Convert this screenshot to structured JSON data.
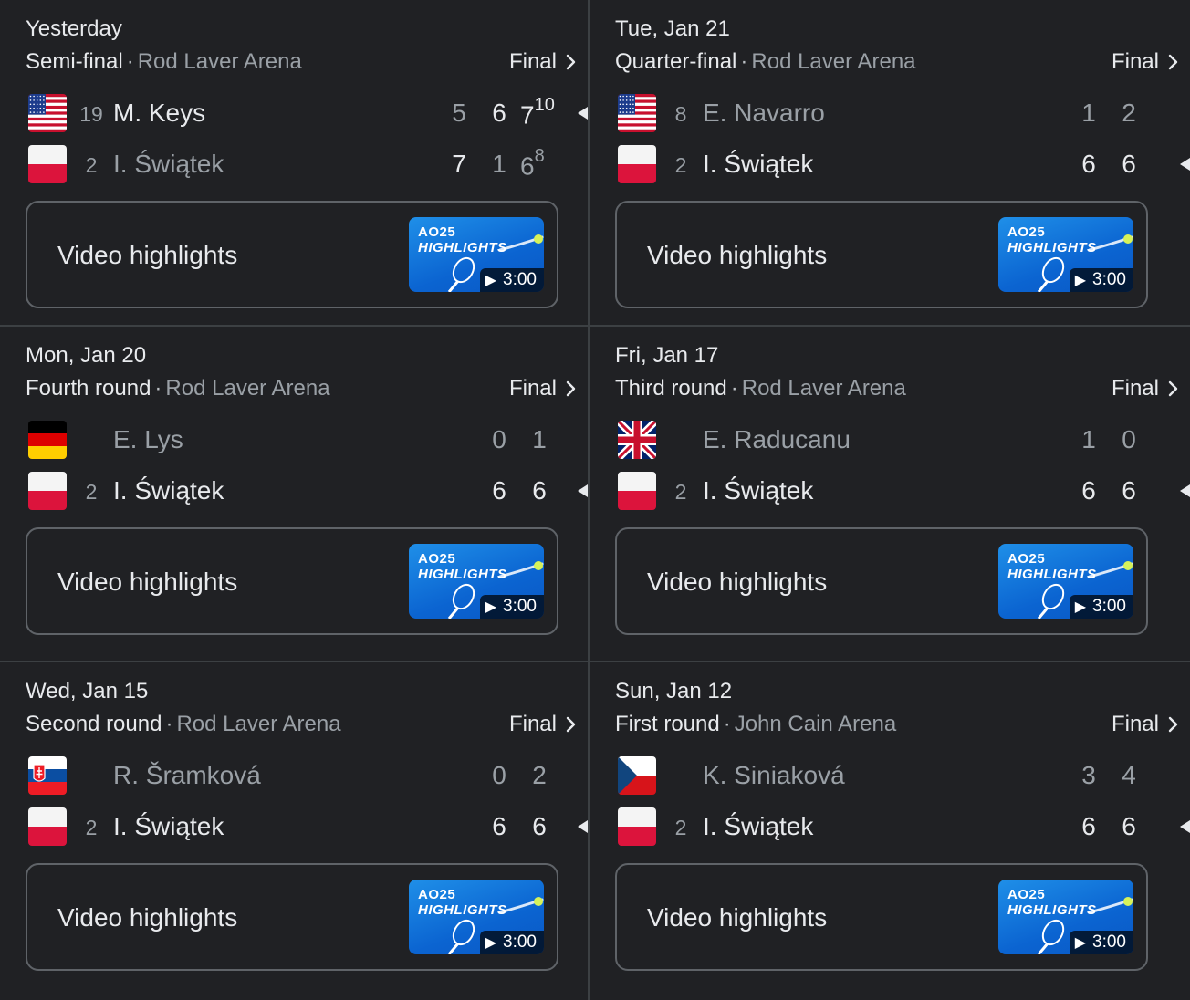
{
  "matches": [
    {
      "date": "Yesterday",
      "round": "Semi-final",
      "venue": "Rod Laver Arena",
      "status": "Final",
      "players": [
        {
          "flag": "usa",
          "seed": "19",
          "name": "M. Keys",
          "winner": true,
          "sets": [
            {
              "v": "5",
              "w": false
            },
            {
              "v": "6",
              "w": true
            },
            {
              "v": "7",
              "tb": "10",
              "w": true
            }
          ]
        },
        {
          "flag": "poland",
          "seed": "2",
          "name": "I. Świątek",
          "winner": false,
          "sets": [
            {
              "v": "7",
              "w": true
            },
            {
              "v": "1",
              "w": false
            },
            {
              "v": "6",
              "tb": "8",
              "w": false
            }
          ]
        }
      ],
      "highlights": {
        "label": "Video highlights",
        "logo": "AO25",
        "title": "HIGHLIGHTS",
        "duration": "3:00"
      }
    },
    {
      "date": "Tue, Jan 21",
      "round": "Quarter-final",
      "venue": "Rod Laver Arena",
      "status": "Final",
      "players": [
        {
          "flag": "usa",
          "seed": "8",
          "name": "E. Navarro",
          "winner": false,
          "sets": [
            {
              "v": "1",
              "w": false
            },
            {
              "v": "2",
              "w": false
            }
          ]
        },
        {
          "flag": "poland",
          "seed": "2",
          "name": "I. Świątek",
          "winner": true,
          "sets": [
            {
              "v": "6",
              "w": true
            },
            {
              "v": "6",
              "w": true
            }
          ]
        }
      ],
      "highlights": {
        "label": "Video highlights",
        "logo": "AO25",
        "title": "HIGHLIGHTS",
        "duration": "3:00"
      }
    },
    {
      "date": "Mon, Jan 20",
      "round": "Fourth round",
      "venue": "Rod Laver Arena",
      "status": "Final",
      "players": [
        {
          "flag": "germany",
          "seed": "",
          "name": "E. Lys",
          "winner": false,
          "sets": [
            {
              "v": "0",
              "w": false
            },
            {
              "v": "1",
              "w": false
            }
          ]
        },
        {
          "flag": "poland",
          "seed": "2",
          "name": "I. Świątek",
          "winner": true,
          "sets": [
            {
              "v": "6",
              "w": true
            },
            {
              "v": "6",
              "w": true
            }
          ]
        }
      ],
      "highlights": {
        "label": "Video highlights",
        "logo": "AO25",
        "title": "HIGHLIGHTS",
        "duration": "3:00"
      }
    },
    {
      "date": "Fri, Jan 17",
      "round": "Third round",
      "venue": "Rod Laver Arena",
      "status": "Final",
      "players": [
        {
          "flag": "uk",
          "seed": "",
          "name": "E. Raducanu",
          "winner": false,
          "sets": [
            {
              "v": "1",
              "w": false
            },
            {
              "v": "0",
              "w": false
            }
          ]
        },
        {
          "flag": "poland",
          "seed": "2",
          "name": "I. Świątek",
          "winner": true,
          "sets": [
            {
              "v": "6",
              "w": true
            },
            {
              "v": "6",
              "w": true
            }
          ]
        }
      ],
      "highlights": {
        "label": "Video highlights",
        "logo": "AO25",
        "title": "HIGHLIGHTS",
        "duration": "3:00"
      }
    },
    {
      "date": "Wed, Jan 15",
      "round": "Second round",
      "venue": "Rod Laver Arena",
      "status": "Final",
      "players": [
        {
          "flag": "slovakia",
          "seed": "",
          "name": "R. Šramková",
          "winner": false,
          "sets": [
            {
              "v": "0",
              "w": false
            },
            {
              "v": "2",
              "w": false
            }
          ]
        },
        {
          "flag": "poland",
          "seed": "2",
          "name": "I. Świątek",
          "winner": true,
          "sets": [
            {
              "v": "6",
              "w": true
            },
            {
              "v": "6",
              "w": true
            }
          ]
        }
      ],
      "highlights": {
        "label": "Video highlights",
        "logo": "AO25",
        "title": "HIGHLIGHTS",
        "duration": "3:00"
      }
    },
    {
      "date": "Sun, Jan 12",
      "round": "First round",
      "venue": "John Cain Arena",
      "status": "Final",
      "players": [
        {
          "flag": "czechia",
          "seed": "",
          "name": "K. Siniaková",
          "winner": false,
          "sets": [
            {
              "v": "3",
              "w": false
            },
            {
              "v": "4",
              "w": false
            }
          ]
        },
        {
          "flag": "poland",
          "seed": "2",
          "name": "I. Świątek",
          "winner": true,
          "sets": [
            {
              "v": "6",
              "w": true
            },
            {
              "v": "6",
              "w": true
            }
          ]
        }
      ],
      "highlights": {
        "label": "Video highlights",
        "logo": "AO25",
        "title": "HIGHLIGHTS",
        "duration": "3:00"
      }
    }
  ],
  "icons": {
    "status_chevron": "chevron-right-icon",
    "winner_marker": "triangle-left-icon",
    "play": "play-icon"
  },
  "colors": {
    "background": "#202124",
    "divider": "#3c4043",
    "text_primary": "#e8eaed",
    "text_secondary": "#9aa0a6",
    "highlight_border": "#5f6368",
    "thumbnail_blue": "#0b64d1"
  }
}
